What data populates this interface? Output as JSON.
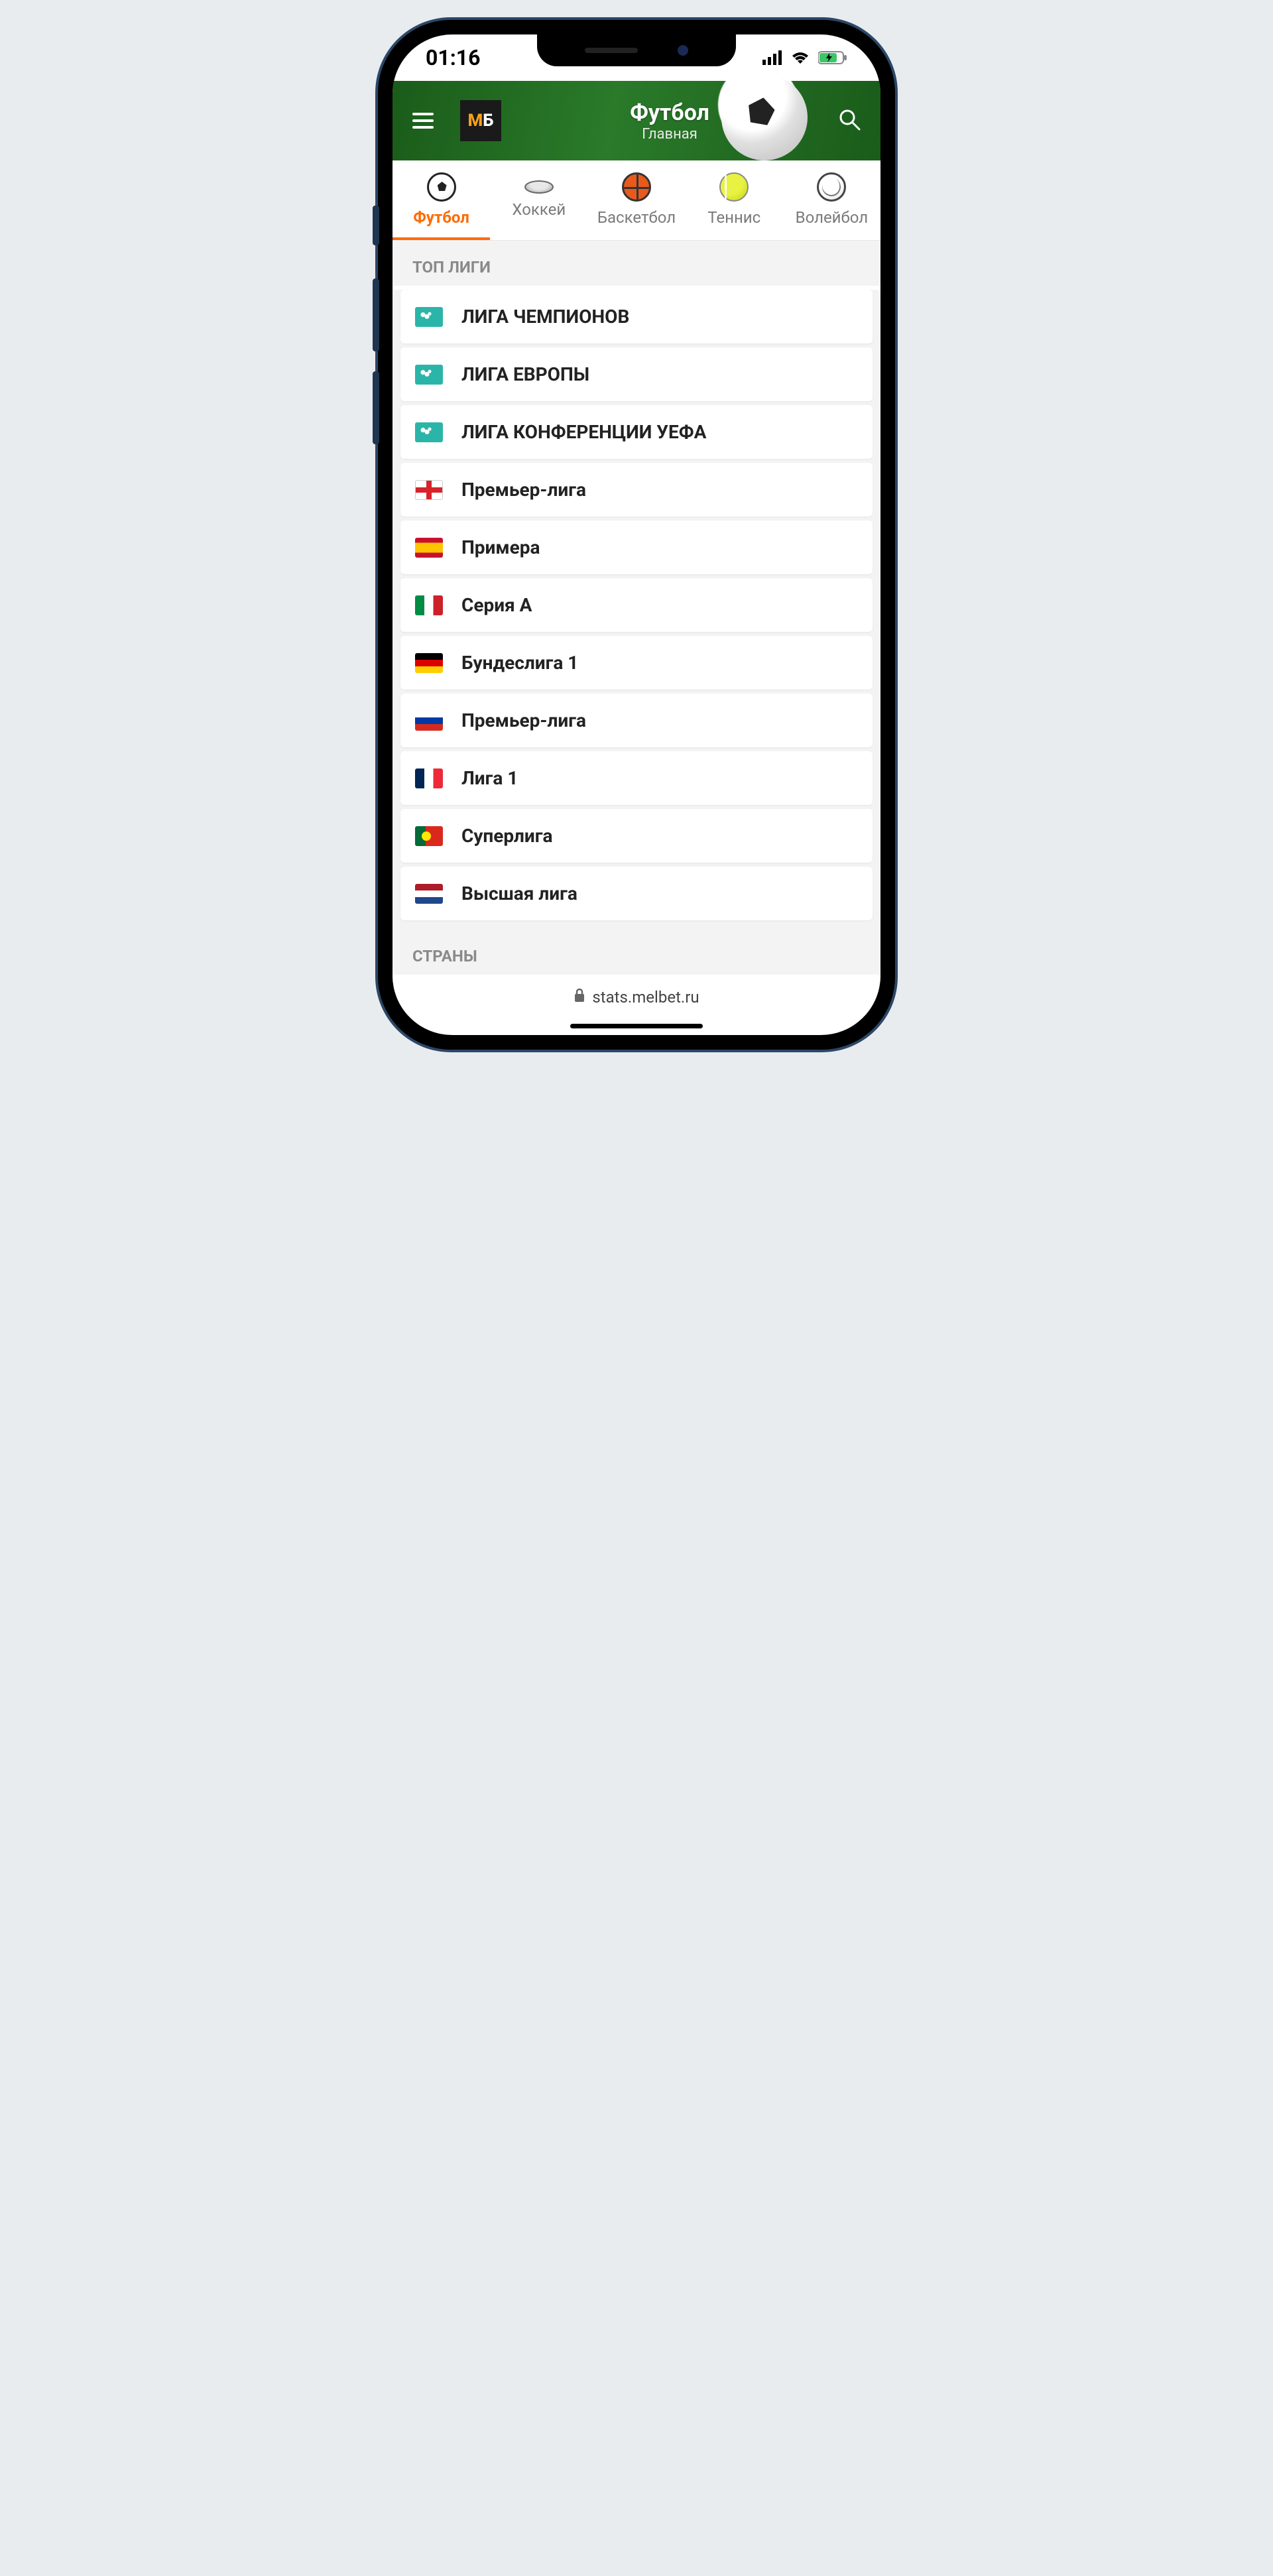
{
  "status": {
    "time": "01:16"
  },
  "header": {
    "title": "Футбол",
    "subtitle": "Главная"
  },
  "sports": [
    {
      "label": "Футбол",
      "icon": "soccer",
      "active": true
    },
    {
      "label": "Хоккей",
      "icon": "hockey",
      "active": false
    },
    {
      "label": "Баскетбол",
      "icon": "basket",
      "active": false
    },
    {
      "label": "Теннис",
      "icon": "tennis",
      "active": false
    },
    {
      "label": "Волейбол",
      "icon": "volley",
      "active": false
    }
  ],
  "sections": {
    "top_leagues_title": "ТОП ЛИГИ",
    "countries_title": "СТРАНЫ"
  },
  "leagues": [
    {
      "flag": "eu",
      "name": "ЛИГА ЧЕМПИОНОВ"
    },
    {
      "flag": "eu",
      "name": "ЛИГА ЕВРОПЫ"
    },
    {
      "flag": "eu",
      "name": "ЛИГА КОНФЕРЕНЦИИ УЕФА"
    },
    {
      "flag": "en",
      "name": "Премьер-лига"
    },
    {
      "flag": "es",
      "name": "Примера"
    },
    {
      "flag": "it",
      "name": "Серия А"
    },
    {
      "flag": "de",
      "name": "Бундеслига 1"
    },
    {
      "flag": "ru",
      "name": "Премьер-лига"
    },
    {
      "flag": "fr",
      "name": "Лига 1"
    },
    {
      "flag": "pt",
      "name": "Суперлига"
    },
    {
      "flag": "nl",
      "name": "Высшая лига"
    }
  ],
  "url": "stats.melbet.ru"
}
